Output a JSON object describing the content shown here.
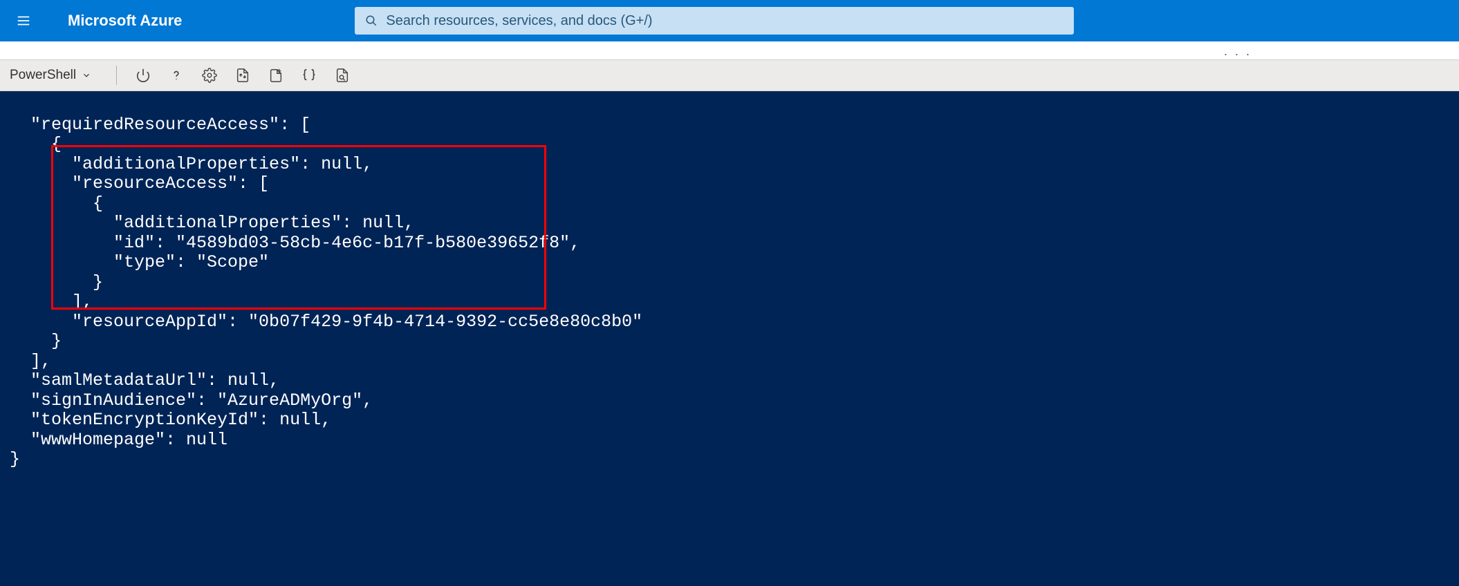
{
  "header": {
    "brand": "Microsoft Azure",
    "search_placeholder": "Search resources, services, and docs (G+/)"
  },
  "toolbar": {
    "shell_label": "PowerShell"
  },
  "terminal": {
    "lines": [
      "  \"requiredResourceAccess\": [",
      "    {",
      "      \"additionalProperties\": null,",
      "      \"resourceAccess\": [",
      "        {",
      "          \"additionalProperties\": null,",
      "          \"id\": \"4589bd03-58cb-4e6c-b17f-b580e39652f8\",",
      "          \"type\": \"Scope\"",
      "        }",
      "      ],",
      "      \"resourceAppId\": \"0b07f429-9f4b-4714-9392-cc5e8e80c8b0\"",
      "    }",
      "  ],",
      "  \"samlMetadataUrl\": null,",
      "  \"signInAudience\": \"AzureADMyOrg\",",
      "  \"tokenEncryptionKeyId\": null,",
      "  \"wwwHomepage\": null",
      "}"
    ]
  },
  "dots": ". . ."
}
